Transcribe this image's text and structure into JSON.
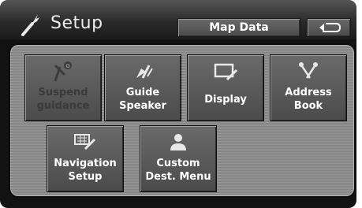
{
  "header": {
    "title": "Setup",
    "title_icon": "wrench-icon",
    "map_data_label": "Map Data",
    "back_icon": "return-arrow-icon"
  },
  "tiles": [
    {
      "line1": "Suspend",
      "line2": "guidance",
      "icon": "suspend-guidance-icon",
      "enabled": false
    },
    {
      "line1": "Guide",
      "line2": "Speaker",
      "icon": "speaker-icon",
      "enabled": true
    },
    {
      "line1": "Display",
      "line2": "",
      "icon": "display-monitor-icon",
      "enabled": true
    },
    {
      "line1": "Address",
      "line2": "Book",
      "icon": "pushpin-icon",
      "enabled": true
    },
    {
      "line1": "Navigation",
      "line2": "Setup",
      "icon": "navigation-map-icon",
      "enabled": true
    },
    {
      "line1": "Custom",
      "line2": "Dest. Menu",
      "icon": "person-icon",
      "enabled": true
    }
  ],
  "colors": {
    "screen_bg": "#121212",
    "panel_bg": "#8c8c8c",
    "button_face": "#5a5a5a",
    "text": "#ffffff",
    "disabled_text": "#3a3a3a"
  }
}
